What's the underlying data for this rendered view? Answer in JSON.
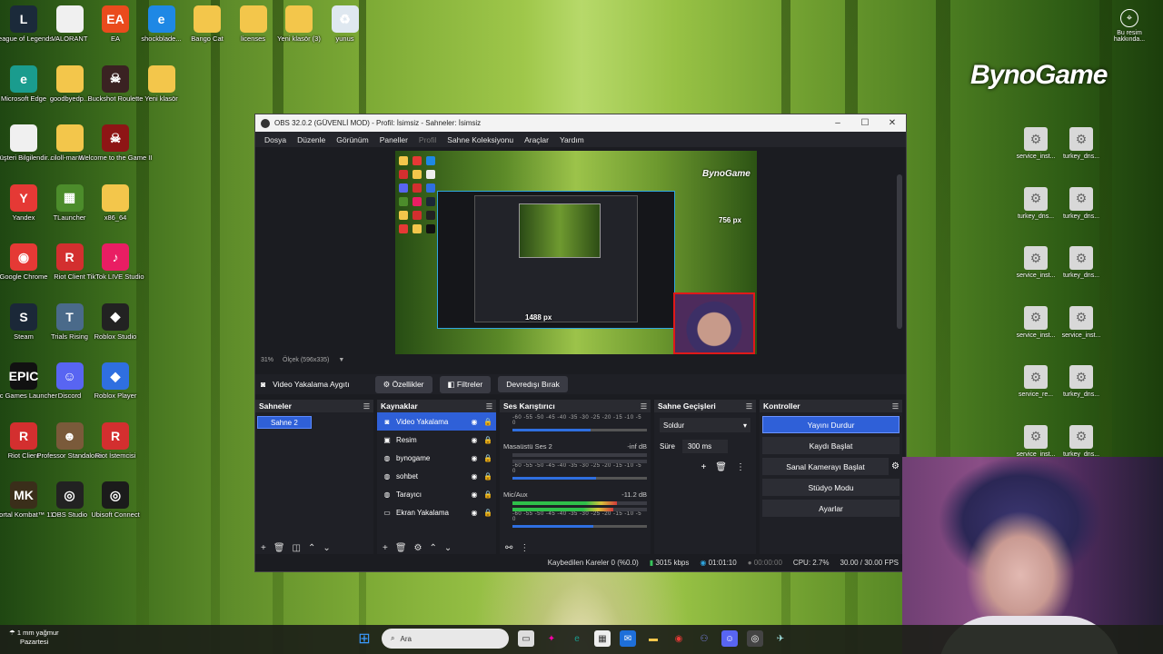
{
  "desktop": {
    "left_icons": [
      {
        "label": "League of Legends",
        "icon": "league-of-legends-icon",
        "color": "#1b2a3a",
        "glyph": "L"
      },
      {
        "label": "VALORANT",
        "icon": "file-icon",
        "color": "#f0f0f0",
        "glyph": ""
      },
      {
        "label": "EA",
        "icon": "ea-icon",
        "color": "#ea4b1d",
        "glyph": "EA"
      },
      {
        "label": "shockblade...",
        "icon": "edge-legacy-icon",
        "color": "#1e88e5",
        "glyph": "e"
      },
      {
        "label": "Bango Cat",
        "icon": "folder-icon",
        "color": "#f3c64b",
        "glyph": ""
      },
      {
        "label": "licenses",
        "icon": "folder-icon",
        "color": "#f3c64b",
        "glyph": ""
      },
      {
        "label": "Yeni klasör (3)",
        "icon": "folder-icon",
        "color": "#f3c64b",
        "glyph": ""
      },
      {
        "label": "yunus",
        "icon": "recycle-bin-icon",
        "color": "#dfe8f0",
        "glyph": "♻"
      },
      {
        "label": "Microsoft Edge",
        "icon": "edge-icon",
        "color": "#1a9c8e",
        "glyph": "e"
      },
      {
        "label": "goodbyedp...",
        "icon": "folder-icon",
        "color": "#f3c64b",
        "glyph": ""
      },
      {
        "label": "Buckshot Roulette",
        "icon": "buckshot-icon",
        "color": "#3a2222",
        "glyph": "☠"
      },
      {
        "label": "Yeni klasör",
        "icon": "folder-icon",
        "color": "#f3c64b",
        "glyph": ""
      },
      {
        "label": "Müşteri Bilgilendir...",
        "icon": "file-icon",
        "color": "#f0f0f0",
        "glyph": ""
      },
      {
        "label": "ciloll-mana...",
        "icon": "folder-icon",
        "color": "#f3c64b",
        "glyph": ""
      },
      {
        "label": "Welcome to the Game II",
        "icon": "skull-icon",
        "color": "#8e1515",
        "glyph": "☠"
      },
      {
        "label": "Yandex",
        "icon": "yandex-icon",
        "color": "#e53935",
        "glyph": "Y"
      },
      {
        "label": "TLauncher",
        "icon": "tlauncher-icon",
        "color": "#4c8c2b",
        "glyph": "▦"
      },
      {
        "label": "x86_64",
        "icon": "folder-icon",
        "color": "#f3c64b",
        "glyph": ""
      },
      {
        "label": "Google Chrome",
        "icon": "chrome-icon",
        "color": "#e53935",
        "glyph": "◉"
      },
      {
        "label": "Riot Client",
        "icon": "riot-client-icon",
        "color": "#d32f2f",
        "glyph": "R"
      },
      {
        "label": "TikTok LIVE Studio",
        "icon": "tiktok-icon",
        "color": "#e91e63",
        "glyph": "♪"
      },
      {
        "label": "Steam",
        "icon": "steam-icon",
        "color": "#1b2838",
        "glyph": "S"
      },
      {
        "label": "Trials Rising",
        "icon": "trials-rising-icon",
        "color": "#4a6a8a",
        "glyph": "T"
      },
      {
        "label": "Roblox Studio",
        "icon": "roblox-studio-icon",
        "color": "#222222",
        "glyph": "◆"
      },
      {
        "label": "Epic Games Launcher",
        "icon": "epic-games-icon",
        "color": "#111111",
        "glyph": "EPIC"
      },
      {
        "label": "Discord",
        "icon": "discord-icon",
        "color": "#5865f2",
        "glyph": "☺"
      },
      {
        "label": "Roblox Player",
        "icon": "roblox-player-icon",
        "color": "#2f6fe0",
        "glyph": "◆"
      },
      {
        "label": "Riot Client",
        "icon": "riot-client-icon",
        "color": "#d32f2f",
        "glyph": "R"
      },
      {
        "label": "Professor Standalone",
        "icon": "professor-icon",
        "color": "#7a5a3a",
        "glyph": "☻"
      },
      {
        "label": "Riot İstemcisi",
        "icon": "riot-client-icon",
        "color": "#d32f2f",
        "glyph": "R"
      },
      {
        "label": "Mortal Kombat™ 11",
        "icon": "mortal-kombat-icon",
        "color": "#3a2e1a",
        "glyph": "MK"
      },
      {
        "label": "OBS Studio",
        "icon": "obs-icon",
        "color": "#222222",
        "glyph": "◎"
      },
      {
        "label": "Ubisoft Connect",
        "icon": "ubisoft-icon",
        "color": "#1b1b1b",
        "glyph": "◎"
      }
    ],
    "right_icons": [
      {
        "label": "service_inst..."
      },
      {
        "label": "turkey_dns..."
      },
      {
        "label": "turkey_dns..."
      },
      {
        "label": "turkey_dns..."
      },
      {
        "label": "service_inst..."
      },
      {
        "label": "turkey_dns..."
      },
      {
        "label": "service_inst..."
      },
      {
        "label": "service_inst..."
      },
      {
        "label": "service_re..."
      },
      {
        "label": "turkey_dns..."
      },
      {
        "label": "service_inst..."
      },
      {
        "label": "turkey_dns..."
      },
      {
        "label": "turkey_dns..."
      },
      {
        "label": "service_inst..."
      }
    ],
    "about_picture": "Bu resim hakkında...",
    "brand": "BynoGame"
  },
  "obs": {
    "title": "OBS 32.0.2 (GÜVENLİ MOD) - Profil: İsimsiz - Sahneler: İsimsiz",
    "menu": [
      "Dosya",
      "Düzenle",
      "Görünüm",
      "Paneller",
      "Profil",
      "Sahne Koleksiyonu",
      "Araçlar",
      "Yardım"
    ],
    "preview": {
      "zoom": "31%",
      "scale": "Ölçek (596x335)",
      "dim_h": "1488 px",
      "dim_v": "756 px",
      "brand": "BynoGame"
    },
    "source_toolbar": {
      "source_name": "Video Yakalama Aygıtı",
      "properties": "Özellikler",
      "filters": "Filtreler",
      "deactivate": "Devredışı Bırak"
    },
    "scenes": {
      "header": "Sahneler",
      "items": [
        "Sahne 2"
      ]
    },
    "sources": {
      "header": "Kaynaklar",
      "items": [
        {
          "name": "Video Yakalama",
          "icon": "camera-icon"
        },
        {
          "name": "Resim",
          "icon": "image-icon"
        },
        {
          "name": "bynogame",
          "icon": "globe-icon"
        },
        {
          "name": "sohbet",
          "icon": "globe-icon"
        },
        {
          "name": "Tarayıcı",
          "icon": "globe-icon"
        },
        {
          "name": "Ekran Yakalama",
          "icon": "monitor-icon"
        }
      ]
    },
    "mixer": {
      "header": "Ses Karıştırıcı",
      "ticks": "-60 -55 -50 -45 -40 -35 -30 -25 -20 -15 -10 -5 0",
      "channels": [
        {
          "name": "Masaüstü Ses 2",
          "level": "-inf dB",
          "meter": 0,
          "volume": 0.62
        },
        {
          "name": "Mic/Aux",
          "level": "-11.2 dB",
          "meter": 0.78,
          "volume": 0.6
        }
      ]
    },
    "transitions": {
      "header": "Sahne Geçişleri",
      "selected": "Soldur",
      "duration_label": "Süre",
      "duration": "300 ms"
    },
    "controls": {
      "header": "Kontroller",
      "buttons": [
        "Yayını Durdur",
        "Kaydı Başlat",
        "Sanal Kamerayı Başlat",
        "Stüdyo Modu",
        "Ayarlar"
      ]
    },
    "status": {
      "dropped": "Kaybedilen Kareler 0 (%0.0)",
      "bitrate": "3015 kbps",
      "live_time": "01:01:10",
      "rec_time": "00:00:00",
      "cpu": "CPU: 2.7%",
      "fps": "30.00 / 30.00 FPS"
    }
  },
  "taskbar": {
    "weather_line1": "1 mm yağmur",
    "weather_line2": "Pazartesi",
    "search_placeholder": "Ara"
  }
}
